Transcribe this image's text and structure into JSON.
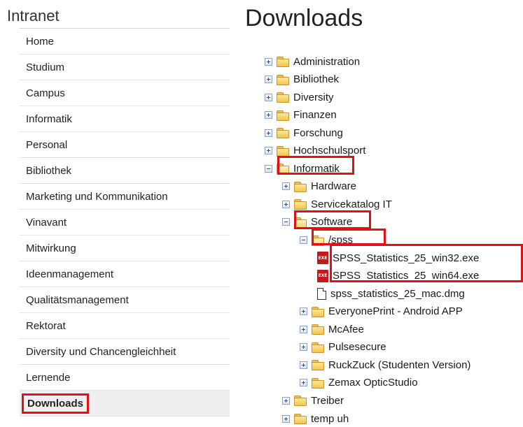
{
  "sidebar": {
    "title": "Intranet",
    "items": [
      {
        "label": "Home"
      },
      {
        "label": "Studium"
      },
      {
        "label": "Campus"
      },
      {
        "label": "Informatik"
      },
      {
        "label": "Personal"
      },
      {
        "label": "Bibliothek"
      },
      {
        "label": "Marketing und Kommunikation"
      },
      {
        "label": "Vinavant"
      },
      {
        "label": "Mitwirkung"
      },
      {
        "label": "Ideenmanagement"
      },
      {
        "label": "Qualitätsmanagement"
      },
      {
        "label": "Rektorat"
      },
      {
        "label": "Diversity und Chancengleichheit"
      },
      {
        "label": "Lernende"
      },
      {
        "label": "Downloads",
        "active": true
      }
    ]
  },
  "main": {
    "title": "Downloads",
    "tree": [
      {
        "label": "Administration",
        "level": 0,
        "type": "folder",
        "toggle": "plus"
      },
      {
        "label": "Bibliothek",
        "level": 0,
        "type": "folder",
        "toggle": "plus"
      },
      {
        "label": "Diversity",
        "level": 0,
        "type": "folder",
        "toggle": "plus"
      },
      {
        "label": "Finanzen",
        "level": 0,
        "type": "folder",
        "toggle": "plus"
      },
      {
        "label": "Forschung",
        "level": 0,
        "type": "folder",
        "toggle": "plus"
      },
      {
        "label": "Hochschulsport",
        "level": 0,
        "type": "folder",
        "toggle": "plus"
      },
      {
        "label": "Informatik",
        "level": 0,
        "type": "folder",
        "toggle": "minus",
        "open": true,
        "highlight": true
      },
      {
        "label": "Hardware",
        "level": 1,
        "type": "folder",
        "toggle": "plus"
      },
      {
        "label": "Servicekatalog IT",
        "level": 1,
        "type": "folder",
        "toggle": "plus"
      },
      {
        "label": "Software",
        "level": 1,
        "type": "folder",
        "toggle": "minus",
        "open": true,
        "highlight": true
      },
      {
        "label": "/spss",
        "level": 2,
        "type": "folder",
        "toggle": "minus",
        "open": true,
        "highlight": true
      },
      {
        "label": "SPSS_Statistics_25_win32.exe",
        "level": 3,
        "type": "exe",
        "highlight": true
      },
      {
        "label": "SPSS_Statistics_25_win64.exe",
        "level": 3,
        "type": "exe",
        "highlight": true
      },
      {
        "label": "spss_statistics_25_mac.dmg",
        "level": 3,
        "type": "file"
      },
      {
        "label": "EveryonePrint - Android APP",
        "level": 2,
        "type": "folder",
        "toggle": "plus"
      },
      {
        "label": "McAfee",
        "level": 2,
        "type": "folder",
        "toggle": "plus"
      },
      {
        "label": "Pulsesecure",
        "level": 2,
        "type": "folder",
        "toggle": "plus"
      },
      {
        "label": "RuckZuck (Studenten Version)",
        "level": 2,
        "type": "folder",
        "toggle": "plus"
      },
      {
        "label": "Zemax OpticStudio",
        "level": 2,
        "type": "folder",
        "toggle": "plus"
      },
      {
        "label": "Treiber",
        "level": 1,
        "type": "folder",
        "toggle": "plus"
      },
      {
        "label": "temp uh",
        "level": 1,
        "type": "folder",
        "toggle": "plus"
      }
    ]
  },
  "colors": {
    "highlight": "#e0101a",
    "folder": "#f2c44c",
    "exe": "#c21a1a"
  },
  "icons": {
    "expand": "plus-box-icon",
    "collapse": "minus-box-icon",
    "folder": "folder-icon",
    "exe": "exe-file-icon",
    "file": "file-icon"
  }
}
